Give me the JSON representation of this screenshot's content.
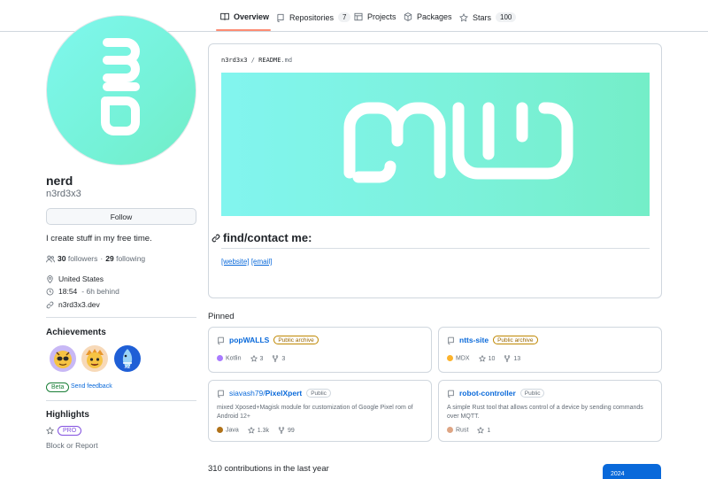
{
  "tabs": [
    {
      "label": "Overview",
      "icon": "book-icon",
      "active": true
    },
    {
      "label": "Repositories",
      "icon": "repo-icon",
      "count": "7"
    },
    {
      "label": "Projects",
      "icon": "table-icon"
    },
    {
      "label": "Packages",
      "icon": "package-icon"
    },
    {
      "label": "Stars",
      "icon": "star-icon",
      "count": "100"
    }
  ],
  "profile": {
    "name": "nerd",
    "login": "n3rd3x3",
    "follow_label": "Follow",
    "bio": "I create stuff in my free time.",
    "followers_count": "30",
    "followers_label": "followers",
    "dot": "·",
    "following_count": "29",
    "following_label": "following",
    "location": "United States",
    "time": "18:54",
    "time_note": "- 6h behind",
    "website": "n3rd3x3.dev"
  },
  "achievements": {
    "title": "Achievements",
    "beta_label": "Beta",
    "feedback_label": "Send feedback"
  },
  "highlights": {
    "title": "Highlights",
    "pro_label": "PRO",
    "block_label": "Block or Report"
  },
  "readme": {
    "owner": "n3rd3x3",
    "sep": "/",
    "file": "README",
    "ext": ".md",
    "heading": "find/contact me:",
    "link_website": "[website]",
    "link_email": "[email]"
  },
  "pinned": {
    "title": "Pinned",
    "cards": [
      {
        "owner": "",
        "name": "popWALLS",
        "visibility": "Public archive",
        "description": "",
        "language": "Kotlin",
        "lang_color": "#A97BFF",
        "stars": "3",
        "forks": "3"
      },
      {
        "owner": "",
        "name": "ntts-site",
        "visibility": "Public archive",
        "description": "",
        "language": "MDX",
        "lang_color": "#fcb32c",
        "stars": "10",
        "forks": "13"
      },
      {
        "owner": "siavash79/",
        "name": "PixelXpert",
        "visibility": "Public",
        "description": "mixed Xposed+Magisk module for customization of Google Pixel rom of Android 12+",
        "language": "Java",
        "lang_color": "#b07219",
        "stars": "1.3k",
        "forks": "99"
      },
      {
        "owner": "",
        "name": "robot-controller",
        "visibility": "Public",
        "description": "A simple Rust tool that allows control of a device by sending commands over MQTT.",
        "language": "Rust",
        "lang_color": "#dea584",
        "stars": "1",
        "forks": ""
      }
    ]
  },
  "contributions": {
    "summary": "310 contributions in the last year",
    "year": "2024"
  },
  "colors": {
    "accent_blue": "#0969da",
    "avatar_teal": "#75f2d8",
    "tab_underline": "#fd8c73"
  }
}
